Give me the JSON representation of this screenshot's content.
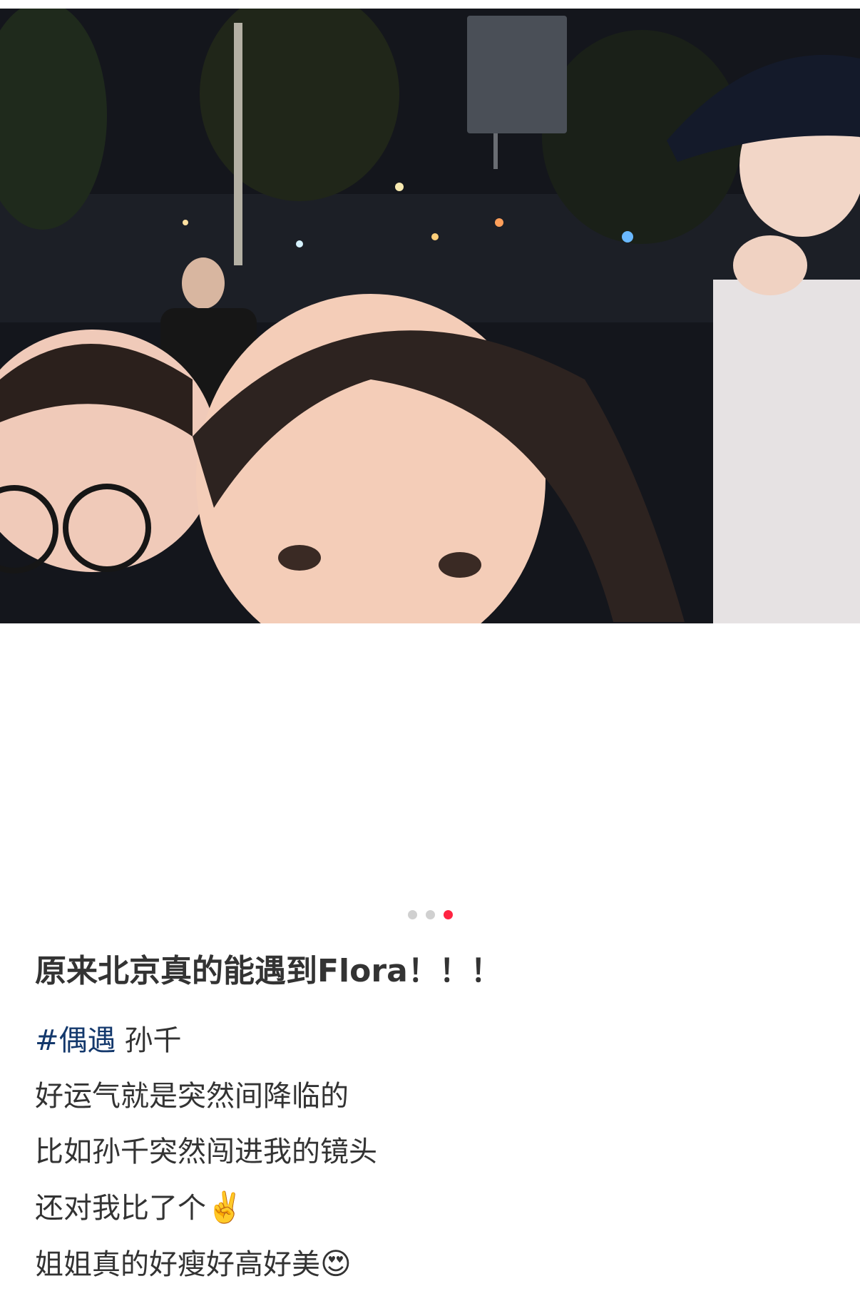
{
  "post": {
    "photo_alt": "",
    "title": "原来北京真的能遇到Flora！！！",
    "hashtag": "#偶遇",
    "tag_name": "孙千",
    "lines": [
      "好运气就是突然间降临的",
      "比如孙千突然闯进我的镜头",
      "还对我比了个",
      "姐姐真的好瘦好高好美"
    ],
    "emoji_victory": "✌️",
    "emoji_heart_eyes": "😍"
  },
  "carousel": {
    "count": 3,
    "active_index": 2,
    "active_color": "#ff2442",
    "inactive_color": "#d0d0d0"
  },
  "colors": {
    "hashtag": "#13386c",
    "text": "#333333"
  }
}
